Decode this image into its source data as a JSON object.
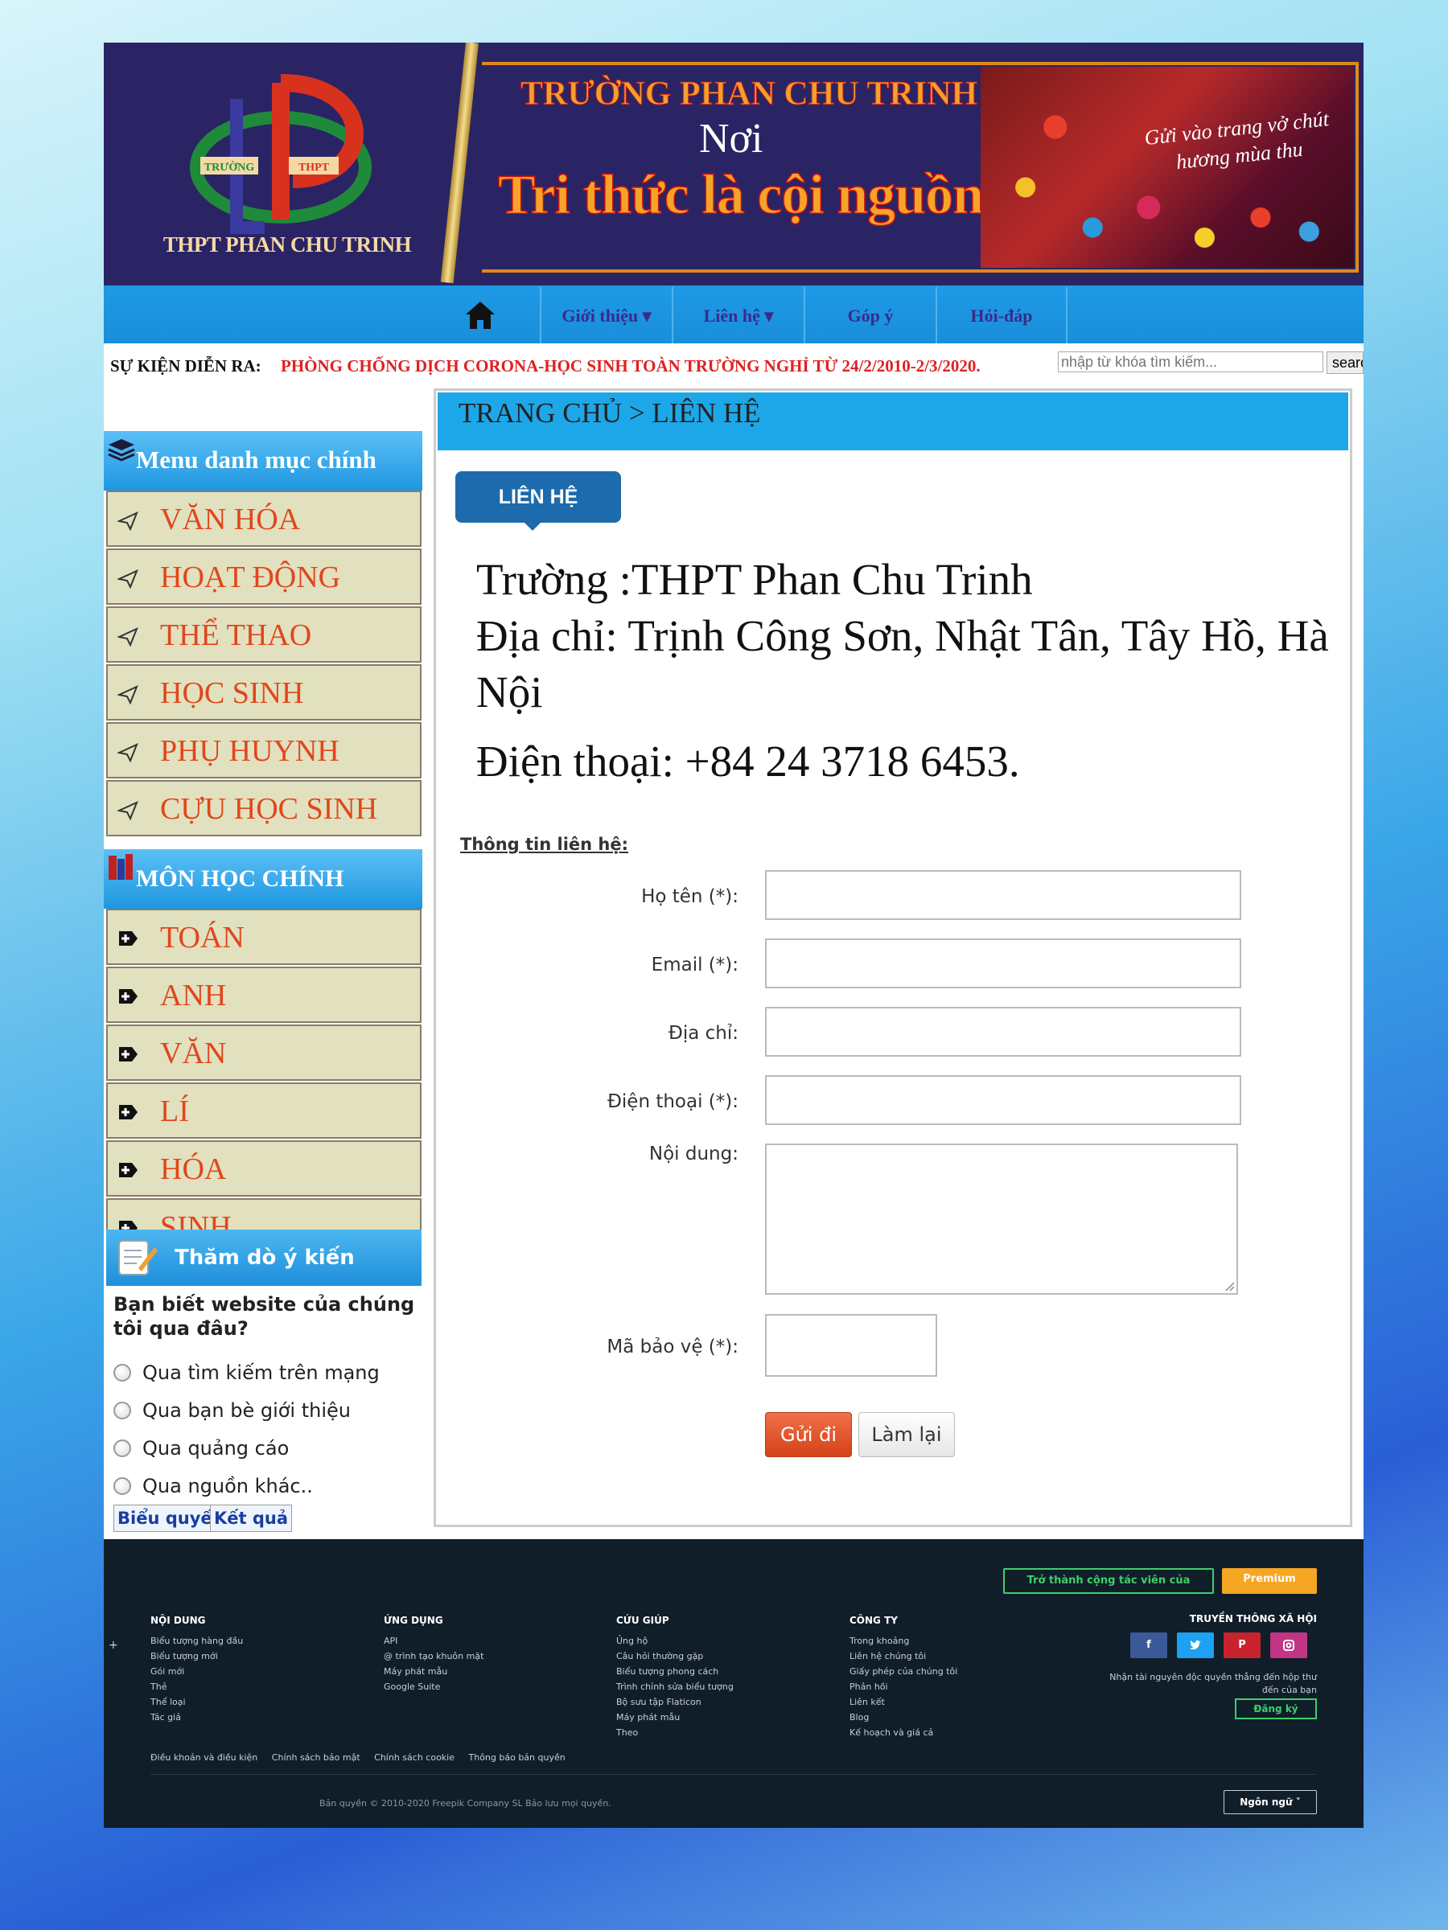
{
  "banner": {
    "logo_text": "THPT PHAN CHU TRINH",
    "logo_left": "TRƯỜNG",
    "logo_right": "THPT",
    "slogan_top": "TRƯỜNG PHAN CHU TRINH",
    "slogan_mid": "Nơi",
    "slogan_big": "Tri thức là cội nguồn sống",
    "photo_text": "Gửi vào trang vở chút hương mùa thu"
  },
  "nav": {
    "items": [
      {
        "label": "Giới thiệu ▾"
      },
      {
        "label": "Liên hệ ▾"
      },
      {
        "label": "Góp ý"
      },
      {
        "label": "Hỏi-đáp"
      }
    ]
  },
  "ticker": {
    "label": "SỰ KIỆN DIỄN RA:",
    "text": "PHÒNG CHỐNG DỊCH CORONA-HỌC SINH TOÀN TRƯỜNG NGHỈ TỪ 24/2/2010-2/3/2020."
  },
  "search": {
    "placeholder": "nhập từ khóa tìm kiếm...",
    "button": "search"
  },
  "sidebar": {
    "menu_title": "Menu danh mục chính",
    "menu_items": [
      "VĂN HÓA",
      "HOẠT ĐỘNG",
      "THỂ THAO",
      "HỌC SINH",
      "PHỤ HUYNH",
      "CỰU HỌC SINH"
    ],
    "subjects_title": "MÔN HỌC CHÍNH",
    "subject_items": [
      "TOÁN",
      "ANH",
      "VĂN",
      "LÍ",
      "HÓA",
      "SINH"
    ]
  },
  "poll": {
    "title": "Thăm dò ý kiến",
    "question": "Bạn biết website của chúng tôi qua đâu?",
    "options": [
      "Qua tìm kiếm trên mạng",
      "Qua bạn bè giới thiệu",
      "Qua quảng cáo",
      "Qua nguồn khác.."
    ],
    "vote_button": "Biểu quyết",
    "result_button": "Kết quả"
  },
  "main": {
    "breadcrumb": "TRANG CHỦ > LIÊN HỆ",
    "tab_label": "LIÊN HỆ",
    "school": "Trường :THPT Phan Chu Trinh",
    "address": "Địa chỉ: Trịnh Công Sơn, Nhật Tân, Tây Hồ, Hà Nội",
    "phone": "Điện thoại: +84 24 3718 6453.",
    "form_title": "Thông tin liên hệ:",
    "fields": {
      "name": "Họ tên (*):",
      "email": "Email (*):",
      "address": "Địa chỉ:",
      "phone": "Điện thoại (*):",
      "content": "Nội dung:",
      "captcha": "Mã bảo vệ (*):"
    },
    "send_button": "Gửi đi",
    "reset_button": "Làm lại"
  },
  "footer": {
    "cta_contributor": "Trở thành cộng tác viên của",
    "cta_premium": "Premium",
    "columns": [
      {
        "heading": "NỘI DUNG",
        "links": [
          "Biểu tượng hàng đầu",
          "Biểu tượng mới",
          "Gói mới",
          "Thẻ",
          "Thể loại",
          "Tác giả"
        ]
      },
      {
        "heading": "ỨNG DỤNG",
        "links": [
          "API",
          "@ trình tạo khuôn mặt",
          "Máy phát mẫu",
          "Google Suite"
        ]
      },
      {
        "heading": "CỨU GIÚP",
        "links": [
          "Ủng hộ",
          "Câu hỏi thường gặp",
          "Biểu tượng phong cách",
          "Trình chỉnh sửa biểu tượng",
          "Bộ sưu tập Flaticon",
          "Máy phát mẫu",
          "Theo"
        ]
      },
      {
        "heading": "CÔNG TY",
        "links": [
          "Trong khoảng",
          "Liên hệ chúng tôi",
          "Giấy phép của chúng tôi",
          "Phản hồi",
          "Liên kết",
          "Blog",
          "Kế hoạch và giá cả"
        ]
      }
    ],
    "social_heading": "TRUYỀN THÔNG XÃ HỘI",
    "social_text": "Nhận tài nguyên độc quyền thẳng đến hộp thư đến của bạn",
    "signup_button": "Đăng ký",
    "bottom_links": [
      "Điều khoản và điều kiện",
      "Chính sách bảo mật",
      "Chính sách cookie",
      "Thông báo bản quyền"
    ],
    "copyright": "Bản quyền © 2010-2020 Freepik Company SL Bảo lưu mọi quyền.",
    "language": "Ngôn ngữ ˅",
    "plus": "+"
  },
  "colors": {
    "banner_bg": "#2a2464",
    "nav_blue": "#1e9ae6",
    "menu_item_bg": "#e1e1bf",
    "menu_text": "#e2461c",
    "ticker_red": "#e02020",
    "send_orange": "#e0522a",
    "footer_bg": "#101e2a",
    "cta_green": "#3ecf6a",
    "cta_premium": "#f5a623"
  }
}
